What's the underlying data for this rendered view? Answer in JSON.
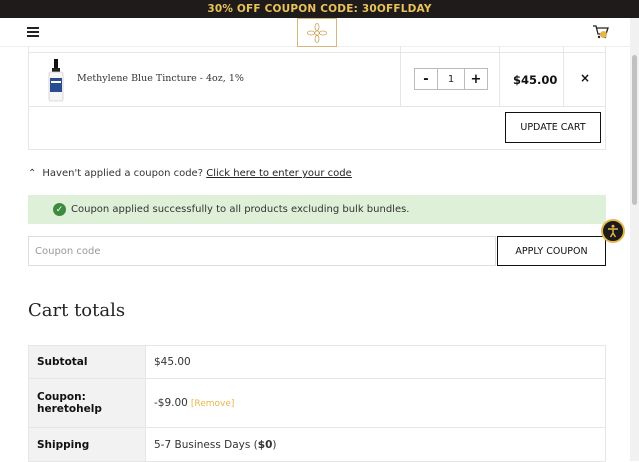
{
  "promo": {
    "text": "30% OFF COUPON CODE: 30OFFLDAY"
  },
  "header": {
    "menu_icon": "hamburger-icon",
    "logo_icon": "flower-logo",
    "cart_icon": "cart-icon"
  },
  "cart": {
    "item": {
      "name": "Methylene Blue Tincture - 4oz, 1%",
      "minus": "-",
      "quantity": "1",
      "plus": "+",
      "price": "$45.00",
      "remove": "×"
    },
    "update_label": "UPDATE CART"
  },
  "coupon": {
    "prompt": "Haven't applied a coupon code?",
    "link": "Click here to enter your code",
    "notice": "Coupon applied successfully to all products excluding bulk bundles.",
    "placeholder": "Coupon code",
    "apply_label": "APPLY COUPON"
  },
  "totals": {
    "title": "Cart totals",
    "subtotal_label": "Subtotal",
    "subtotal_value": "$45.00",
    "coupon_label_1": "Coupon:",
    "coupon_label_2": "heretohelp",
    "coupon_value": "-$9.00",
    "coupon_remove": "[Remove]",
    "shipping_label": "Shipping",
    "shipping_text": "5-7 Business Days (",
    "shipping_amount": "$0",
    "shipping_close": ")"
  },
  "colors": {
    "accent": "#e7b64b",
    "promo_bg": "#1f1b1b",
    "success_bg": "#dff0d8",
    "success_icon": "#3c8b3f"
  }
}
